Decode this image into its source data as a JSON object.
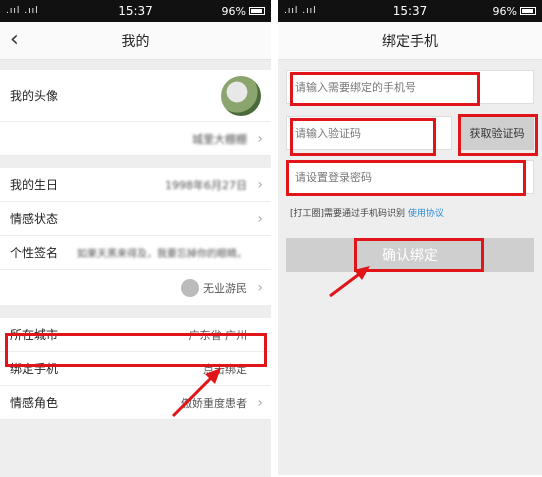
{
  "status_bar": {
    "left": {
      "signal": ".ııl .ııl",
      "time": "15:37",
      "battery": "96%"
    },
    "right": {
      "signal": ".ııl .ııl",
      "time": "15:37",
      "battery": "96%"
    }
  },
  "profile": {
    "title": "我的",
    "rows": {
      "avatar": "我的头像",
      "nickname_value": "城里大棚棚",
      "birthday": "我的生日",
      "birthday_value": "1998年6月27日",
      "relationship": "情感状态",
      "signature": "个性签名",
      "signature_value": "如果天黑来得及，我要忘掉你的眼睛。",
      "identity_value": "无业游民",
      "city": "所在城市",
      "city_value": "广东省 广州",
      "bind_phone": "绑定手机",
      "bind_phone_value": "点击绑定",
      "role": "情感角色",
      "role_value": "傲娇重度患者"
    }
  },
  "bind_form": {
    "title": "绑定手机",
    "phone_placeholder": "请输入需要绑定的手机号",
    "code_placeholder": "请输入验证码",
    "get_code_button": "获取验证码",
    "password_placeholder": "请设置登录密码",
    "agreement_text": "[打工圈]需要通过手机码识别",
    "agreement_link": "使用协议",
    "confirm_button": "确认绑定"
  },
  "colors": {
    "highlight": "#e0151a",
    "link": "#2b8cd8"
  }
}
